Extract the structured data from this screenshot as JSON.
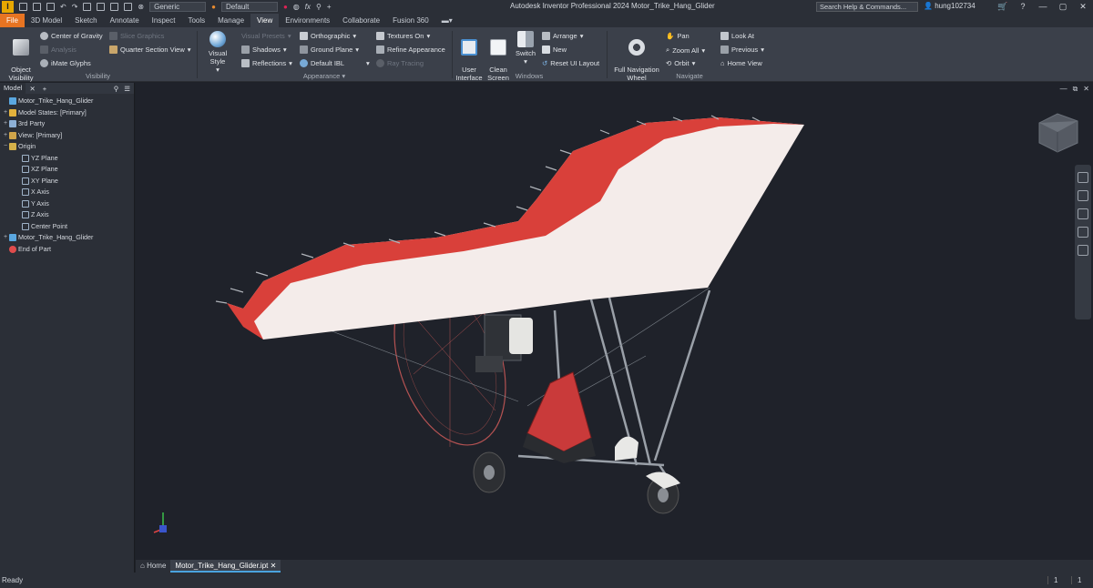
{
  "app": {
    "logo_letter": "I",
    "title": "Autodesk Inventor Professional 2024   Motor_Trike_Hang_Glider",
    "search_placeholder": "Search Help & Commands...",
    "user": "hung102734",
    "material_select": "Generic",
    "appearance_select": "Default",
    "fx_label": "fx"
  },
  "tabs": [
    "File",
    "3D Model",
    "Sketch",
    "Annotate",
    "Inspect",
    "Tools",
    "Manage",
    "View",
    "Environments",
    "Collaborate",
    "Fusion 360"
  ],
  "active_tab": "View",
  "ribbon": {
    "visibility": {
      "label": "Visibility",
      "object_visibility": "Object\nVisibility",
      "center_of_gravity": "Center of Gravity",
      "analysis": "Analysis",
      "imate_glyphs": "iMate Glyphs",
      "slice_graphics": "Slice Graphics",
      "quarter_section_view": "Quarter Section View"
    },
    "appearance": {
      "label": "Appearance",
      "visual_style": "Visual Style",
      "visual_presets": "Visual Presets",
      "shadows": "Shadows",
      "reflections": "Reflections",
      "orthographic": "Orthographic",
      "ground_plane": "Ground Plane",
      "default_ibl": "Default IBL",
      "textures_on": "Textures On",
      "refine_appearance": "Refine Appearance",
      "ray_tracing": "Ray Tracing"
    },
    "windows": {
      "label": "Windows",
      "user_interface": "User\nInterface",
      "clean_screen": "Clean\nScreen",
      "switch": "Switch",
      "arrange": "Arrange",
      "new": "New",
      "reset_ui_layout": "Reset UI Layout"
    },
    "navigate": {
      "label": "Navigate",
      "full_navigation_wheel": "Full Navigation\nWheel",
      "pan": "Pan",
      "zoom_all": "Zoom All",
      "orbit": "Orbit",
      "look_at": "Look At",
      "previous": "Previous",
      "home_view": "Home View"
    }
  },
  "browser": {
    "tab": "Model",
    "nodes": [
      {
        "label": "Motor_Trike_Hang_Glider",
        "level": 0,
        "exp": ""
      },
      {
        "label": "Model States: [Primary]",
        "level": 0,
        "exp": "+"
      },
      {
        "label": "3rd Party",
        "level": 0,
        "exp": "+"
      },
      {
        "label": "View: [Primary]",
        "level": 0,
        "exp": "+"
      },
      {
        "label": "Origin",
        "level": 0,
        "exp": "−"
      },
      {
        "label": "YZ Plane",
        "level": 1,
        "exp": ""
      },
      {
        "label": "XZ Plane",
        "level": 1,
        "exp": ""
      },
      {
        "label": "XY Plane",
        "level": 1,
        "exp": ""
      },
      {
        "label": "X Axis",
        "level": 1,
        "exp": ""
      },
      {
        "label": "Y Axis",
        "level": 1,
        "exp": ""
      },
      {
        "label": "Z Axis",
        "level": 1,
        "exp": ""
      },
      {
        "label": "Center Point",
        "level": 1,
        "exp": ""
      },
      {
        "label": "Motor_Trike_Hang_Glider",
        "level": 0,
        "exp": "+"
      },
      {
        "label": "End of Part",
        "level": 0,
        "exp": ""
      }
    ]
  },
  "doc_tabs": {
    "home": "Home",
    "active": "Motor_Trike_Hang_Glider.ipt"
  },
  "status": {
    "text": "Ready",
    "count_a": "1",
    "count_b": "1"
  },
  "colors": {
    "accent_file": "#e77422",
    "wing_red": "#d9403a",
    "wing_white": "#f4ecea",
    "viewport_bg": "#1f222a"
  }
}
